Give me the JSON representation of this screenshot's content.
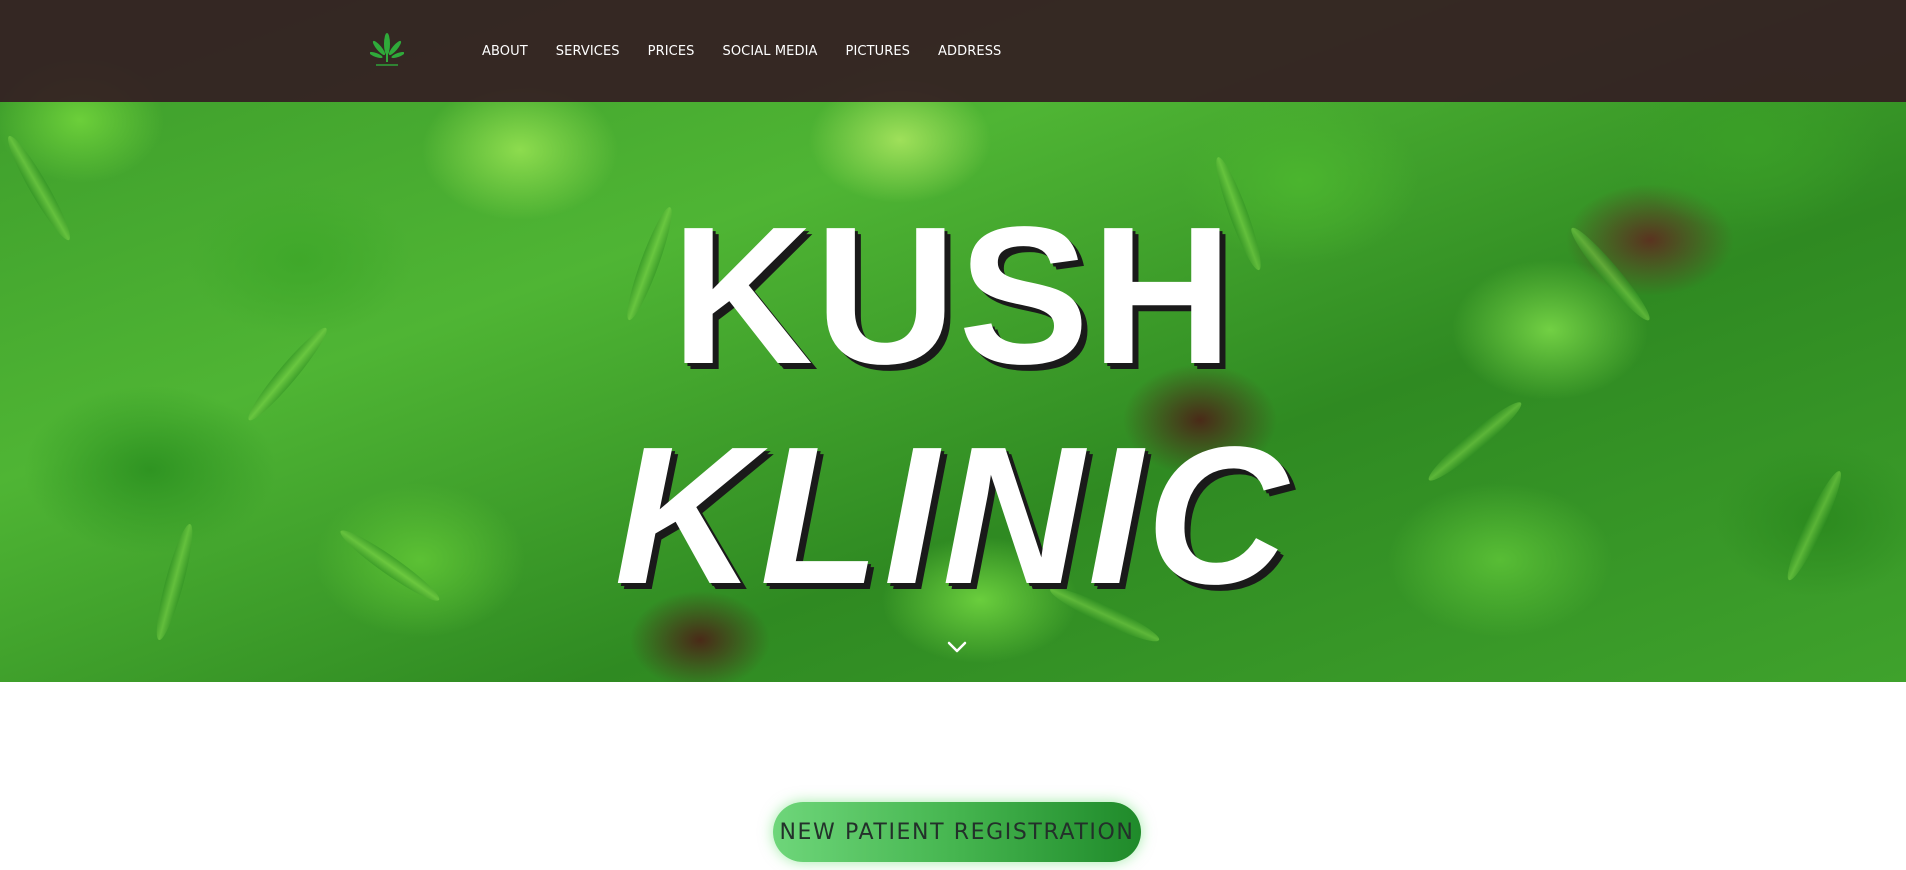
{
  "brand": {
    "logo_icon": "cannabis-leaf-icon"
  },
  "nav": {
    "items": [
      {
        "label": "ABOUT"
      },
      {
        "label": "SERVICES"
      },
      {
        "label": "PRICES"
      },
      {
        "label": "SOCIAL MEDIA"
      },
      {
        "label": "PICTURES"
      },
      {
        "label": "ADDRESS"
      }
    ]
  },
  "hero": {
    "title_line1": "KUSH",
    "title_line2": "KLINIC",
    "scroll_icon": "chevron-down-icon",
    "background": "cannabis-plants-photo"
  },
  "cta": {
    "register_label": "NEW PATIENT REGISTRATION"
  },
  "colors": {
    "navbar_bg": "#341e22",
    "accent_green": "#45b54f",
    "title_text": "#ffffff"
  }
}
